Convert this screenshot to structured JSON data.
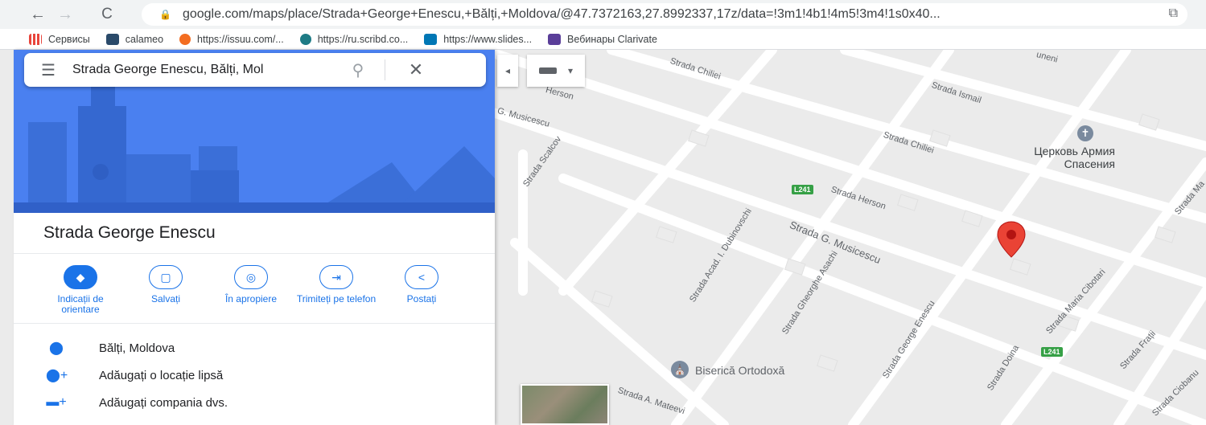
{
  "browser": {
    "nav": {
      "back": "←",
      "forward": "→",
      "reload": "C"
    },
    "url": "google.com/maps/place/Strada+George+Enescu,+Bălți,+Moldova/@47.7372163,27.8992337,17z/data=!3m1!4b1!4m5!3m4!1s0x40...",
    "bookmarks": [
      {
        "label": "Сервисы",
        "color": "#e8453c"
      },
      {
        "label": "calameo",
        "color": "#2a4a6a"
      },
      {
        "label": "https://issuu.com/...",
        "color": "#f36d21"
      },
      {
        "label": "https://ru.scribd.co...",
        "color": "#1e7b85"
      },
      {
        "label": "https://www.slides...",
        "color": "#0077b5"
      },
      {
        "label": "Вебинары Clarivate",
        "color": "#5a3e99"
      }
    ]
  },
  "search": {
    "query": "Strada George Enescu, Bălți, Mol",
    "menu_icon": "☰",
    "search_icon": "⚲",
    "close_icon": "✕"
  },
  "place": {
    "title": "Strada George Enescu",
    "actions": [
      {
        "label": "Indicații de orientare",
        "icon": "◆"
      },
      {
        "label": "Salvați",
        "icon": "▢"
      },
      {
        "label": "În apropiere",
        "icon": "◎"
      },
      {
        "label": "Trimiteți pe telefon",
        "icon": "⇥"
      },
      {
        "label": "Postați",
        "icon": "<"
      }
    ],
    "info": [
      {
        "text": "Bălți, Moldova",
        "icon": "location-pin"
      },
      {
        "text": "Adăugați o locație lipsă",
        "icon": "add-location"
      },
      {
        "text": "Adăugați compania dvs.",
        "icon": "add-business"
      }
    ]
  },
  "map": {
    "streets": [
      "Strada Chiliei",
      "Strada Ismail",
      "Strada Chiliei",
      "Strada Herson",
      "Strada G. Musicescu",
      "Strada Scalcov",
      "Strada Acad. I. Dubinovschi",
      "Strada Gheorghe Asachi",
      "Strada George Enescu",
      "Strada Doina",
      "Strada Maria Cibotari",
      "Strada Frații",
      "Strada A. Mateevi",
      "G. Musicescu",
      "Herson",
      "Strada Ciobanu",
      "Strada Ma",
      "uneni"
    ],
    "road_shields": [
      "L241",
      "L241"
    ],
    "pois": [
      {
        "name": "Церковь Армия Спасения",
        "icon": "church-icon"
      },
      {
        "name": "Biserică Ortodoxă",
        "icon": "church-icon"
      }
    ],
    "colors": {
      "pin": "#ea4335",
      "blue": "#1a73e8"
    }
  }
}
